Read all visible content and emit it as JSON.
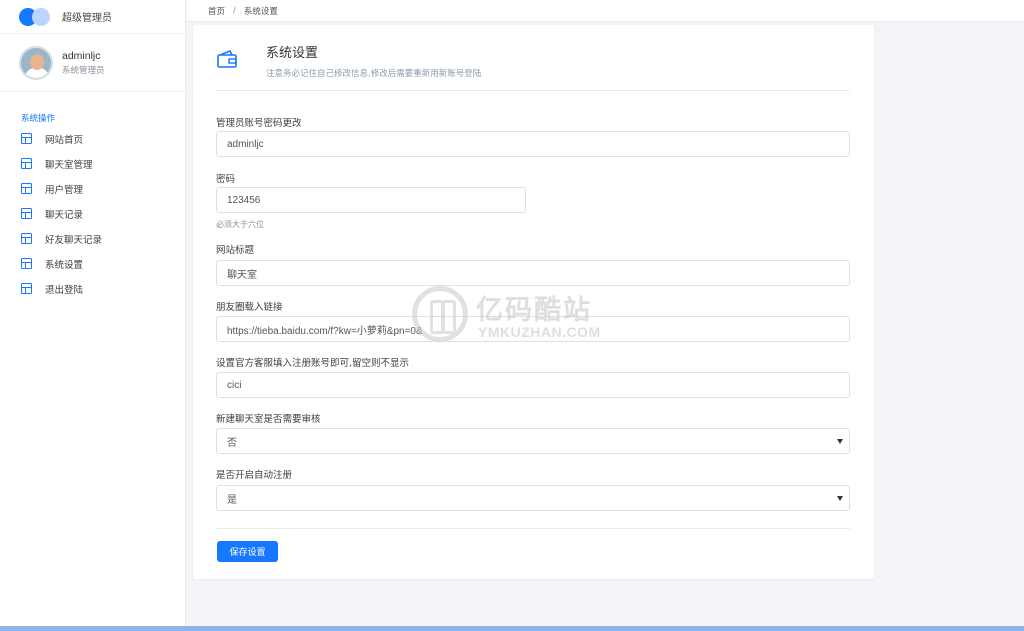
{
  "brand": {
    "name": "超级管理员"
  },
  "user": {
    "name": "adminljc",
    "role": "系统管理员"
  },
  "sidebar": {
    "group_label": "系统操作",
    "items": [
      {
        "label": "网站首页",
        "icon": "layout-icon"
      },
      {
        "label": "聊天室管理",
        "icon": "layout-icon"
      },
      {
        "label": "用户管理",
        "icon": "layout-icon"
      },
      {
        "label": "聊天记录",
        "icon": "layout-icon"
      },
      {
        "label": "好友聊天记录",
        "icon": "layout-icon"
      },
      {
        "label": "系统设置",
        "icon": "layout-icon"
      },
      {
        "label": "退出登陆",
        "icon": "layout-icon"
      }
    ]
  },
  "breadcrumb": {
    "home": "首页",
    "separator": "/",
    "current": "系统设置"
  },
  "card": {
    "title": "系统设置",
    "subtitle": "注意务必记住自己修改信息,修改后需要重新用新账号登陆",
    "icon": "wallet-icon"
  },
  "form": {
    "account": {
      "label": "管理员账号密码更改",
      "value": "adminljc"
    },
    "password": {
      "label": "密码",
      "value": "123456",
      "help": "必须大于六位"
    },
    "site_title": {
      "label": "网站标题",
      "value": "聊天室"
    },
    "moments_link": {
      "label": "朋友圈载入链接",
      "value": "https://tieba.baidu.com/f?kw=小萝莉&pn=0&"
    },
    "service_account": {
      "label": "设置官方客服填入注册账号即可,留空则不显示",
      "value": "cici"
    },
    "room_review": {
      "label": "新建聊天室是否需要审核",
      "value": "否"
    },
    "auto_register": {
      "label": "是否开启自动注册",
      "value": "是"
    }
  },
  "actions": {
    "save_label": "保存设置"
  },
  "watermark": {
    "cn": "亿码酷站",
    "en": "YMKUZHAN.COM"
  },
  "colors": {
    "primary": "#1677ff",
    "background": "#f2f4f8"
  }
}
